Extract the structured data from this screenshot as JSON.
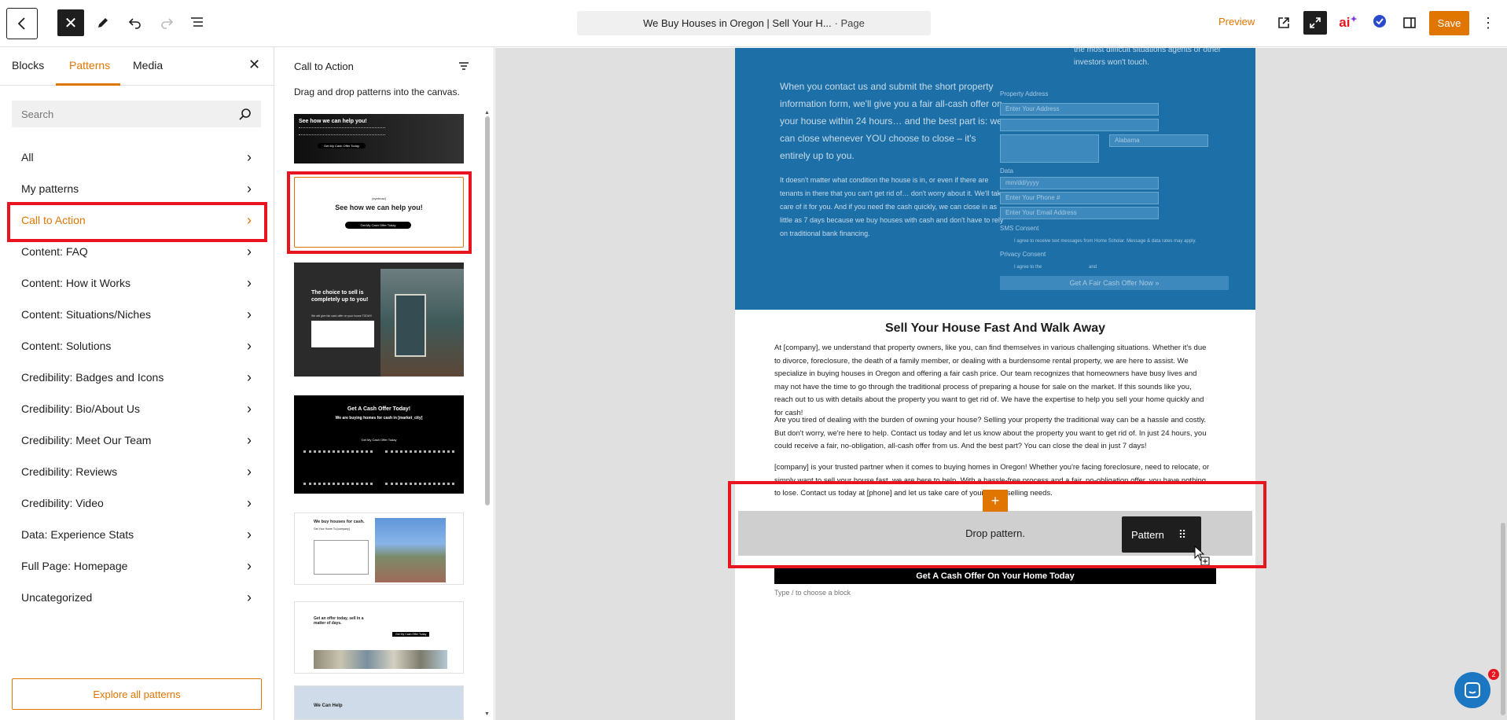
{
  "topbar": {
    "doc_title": "We Buy Houses in Oregon | Sell Your H...",
    "doc_type": "· Page",
    "preview_label": "Preview",
    "save_label": "Save",
    "ai_label": "ai"
  },
  "inserter": {
    "tabs": [
      "Blocks",
      "Patterns",
      "Media"
    ],
    "active_tab": "Patterns",
    "search_placeholder": "Search",
    "categories": [
      "All",
      "My patterns",
      "Call to Action",
      "Content: FAQ",
      "Content: How it Works",
      "Content: Situations/Niches",
      "Content: Solutions",
      "Credibility: Badges and Icons",
      "Credibility: Bio/About Us",
      "Credibility: Meet Our Team",
      "Credibility: Reviews",
      "Credibility: Video",
      "Data: Experience Stats",
      "Full Page: Homepage",
      "Uncategorized"
    ],
    "selected_category": "Call to Action",
    "explore_label": "Explore all patterns"
  },
  "patterns_panel": {
    "title": "Call to Action",
    "description": "Drag and drop patterns into the canvas.",
    "thumbs": [
      {
        "heading": "See how we can help you!",
        "button": "Get My Cash Offer Today"
      },
      {
        "eyebrow": "[eyebrow]",
        "heading": "See how we can help you!",
        "button": "Get My Cash Offer Today"
      },
      {
        "heading": "The choice to sell is completely up to you!",
        "sub": "We will give fair cash offer on your house TODAY!"
      },
      {
        "heading": "Get A Cash Offer Today!",
        "sub": "We are buying homes for cash in [market_city]",
        "button": "Get My Cash Offer Today"
      },
      {
        "heading": "We buy houses for cash.",
        "sub": "Get Your Home To [company]"
      },
      {
        "heading": "Get an offer today, sell in a matter of days.",
        "button": "Get My Cash Offer Today"
      },
      {
        "heading": "We Can Help"
      }
    ]
  },
  "canvas": {
    "hero_top": "the most difficult situations agents or other investors won't touch.",
    "hero_lead": "When you contact us and submit the short property information form, we'll give you a fair all-cash offer on your house within 24 hours… and the best part is: we can close whenever YOU choose to close – it's entirely up to you.",
    "hero_body": "It doesn't matter what condition the house is in, or even if there are tenants in there that you can't get rid of… don't worry about it. We'll take care of it for you. And if you need the cash quickly, we can close in as little as 7 days because we buy houses with cash and don't have to rely on traditional bank financing.",
    "form": {
      "property_address_label": "Property Address",
      "address_placeholder": "Enter Your Address",
      "state_value": "Alabama",
      "date_label": "Data",
      "date_placeholder": "mm/dd/yyyy",
      "phone_placeholder": "Enter Your Phone #",
      "email_placeholder": "Enter Your Email Address",
      "sms_label": "SMS Consent",
      "sms_text": "I agree to receive text messages from Home Scholar. Message & data rates may apply.",
      "privacy_label": "Privacy Consent",
      "privacy_text": "I agree to the",
      "privacy_and": "and",
      "submit_label": "Get A Fair Cash Offer Now »"
    },
    "section_heading": "Sell Your House Fast And Walk Away",
    "paragraph1": "At [company], we understand that property owners, like you, can find themselves in various challenging situations. Whether it's due to divorce, foreclosure, the death of a family member, or dealing with a burdensome rental property, we are here to assist. We specialize in buying houses in Oregon and offering a fair cash price. Our team recognizes that homeowners have busy lives and may not have the time to go through the traditional process of preparing a house for sale on the market. If this sounds like you, reach out to us with details about the property you want to get rid of. We have the expertise to help you sell your home quickly and for cash!",
    "paragraph2": "Are you tired of dealing with the burden of owning your house? Selling your property the traditional way can be a hassle and costly. But don't worry, we're here to help. Contact us today and let us know about the property you want to get rid of. In just 24 hours, you could receive a fair, no-obligation, all-cash offer from us. And the best part? You can close the deal in just 7 days!",
    "paragraph3": "[company] is your trusted partner when it comes to buying homes in Oregon! Whether you're facing foreclosure, need to relocate, or simply want to sell your house fast, we are here to help. With a hassle-free process and a fair, no-obligation offer, you have nothing to lose. Contact us today at [phone] and let us take care of your home selling needs.",
    "drop_label": "Drop pattern.",
    "pattern_chip": "Pattern",
    "cta_button": "Get A Cash Offer On Your Home Today",
    "type_hint": "Type / to choose a block"
  },
  "chat": {
    "badge_count": "2"
  },
  "colors": {
    "accent": "#e07600",
    "highlight": "#e8141f",
    "hero_blue": "#1d6fa8"
  }
}
